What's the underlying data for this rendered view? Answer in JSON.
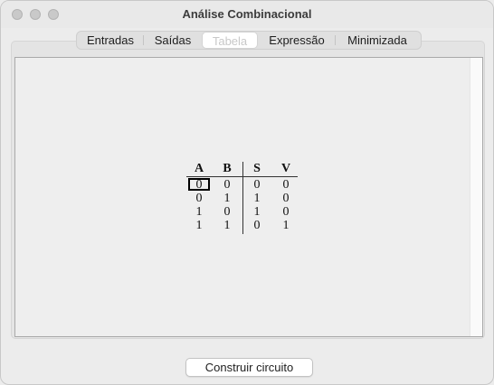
{
  "window": {
    "title": "Análise Combinacional"
  },
  "tabs": [
    {
      "label": "Entradas"
    },
    {
      "label": "Saídas"
    },
    {
      "label": "Tabela"
    },
    {
      "label": "Expressão"
    },
    {
      "label": "Minimizada"
    }
  ],
  "active_tab": "Tabela",
  "truth_table": {
    "inputs": [
      "A",
      "B"
    ],
    "outputs": [
      "S",
      "V"
    ],
    "rows": [
      [
        "0",
        "0",
        "0",
        "0"
      ],
      [
        "0",
        "1",
        "1",
        "0"
      ],
      [
        "1",
        "0",
        "1",
        "0"
      ],
      [
        "1",
        "1",
        "0",
        "1"
      ]
    ]
  },
  "footer": {
    "build_button": "Construir circuito"
  }
}
